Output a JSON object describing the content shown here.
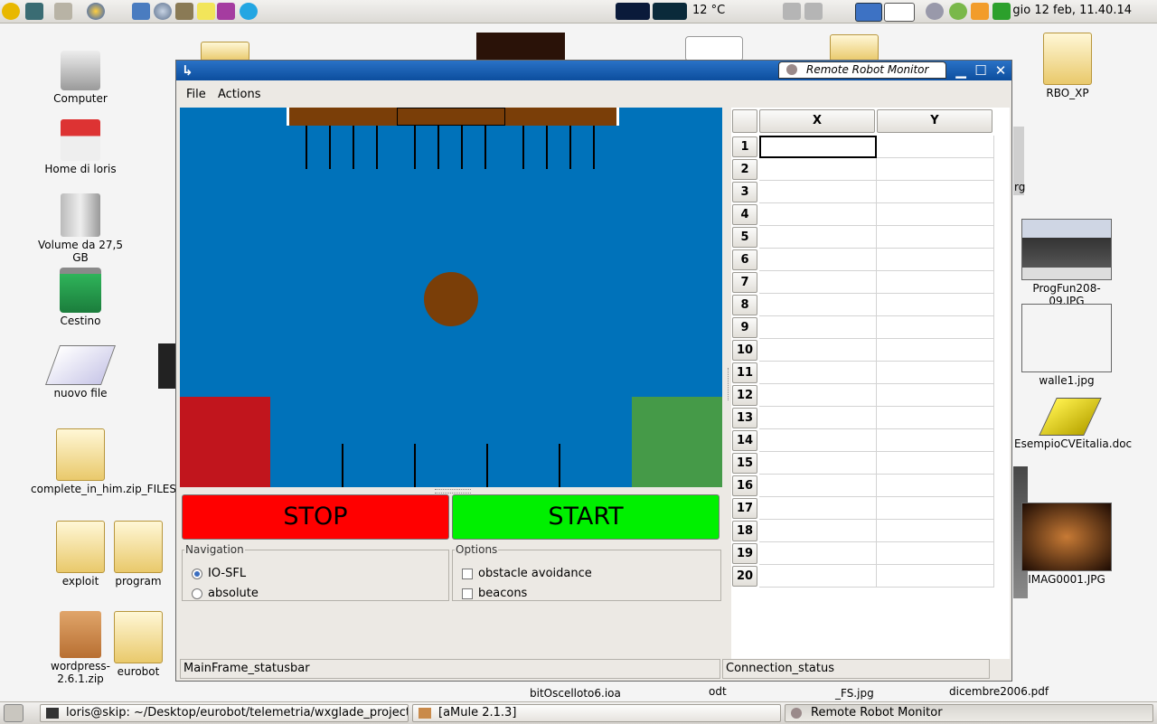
{
  "top_panel": {
    "weather": "12 °C",
    "clock": "gio 12 feb, 11.40.14"
  },
  "desktop": {
    "icons": [
      {
        "label": "Computer"
      },
      {
        "label": "Home di loris"
      },
      {
        "label": "Volume da 27,5 GB"
      },
      {
        "label": "Cestino"
      },
      {
        "label": "nuovo file"
      },
      {
        "label": "complete_in_him.zip_FILES"
      },
      {
        "label": "exploit"
      },
      {
        "label": "program"
      },
      {
        "label": "wordpress-2.6.1.zip"
      },
      {
        "label": "eurobot"
      },
      {
        "label": "RBO_XP"
      },
      {
        "label": "ProgFun208-09.JPG"
      },
      {
        "label": "walle1.jpg"
      },
      {
        "label": "EsempioCVEitalia.doc"
      },
      {
        "label": "IMAG0001.JPG"
      },
      {
        "label": "rg"
      },
      {
        "label": "bitOscelloto6.ioa"
      },
      {
        "label": "odt"
      },
      {
        "label": "_FS.jpg"
      },
      {
        "label": "dicembre2006.pdf"
      }
    ]
  },
  "window": {
    "title": "Remote Robot Monitor",
    "menu": {
      "file": "File",
      "actions": "Actions"
    },
    "buttons": {
      "stop": "STOP",
      "start": "START"
    },
    "navigation": {
      "legend": "Navigation",
      "options": [
        {
          "label": "IO-SFL",
          "selected": true
        },
        {
          "label": "absolute",
          "selected": false
        }
      ]
    },
    "options": {
      "legend": "Options",
      "items": [
        {
          "label": "obstacle avoidance",
          "checked": false
        },
        {
          "label": "beacons",
          "checked": false
        }
      ]
    },
    "grid": {
      "columns": [
        "X",
        "Y"
      ],
      "rows": [
        "1",
        "2",
        "3",
        "4",
        "5",
        "6",
        "7",
        "8",
        "9",
        "10",
        "11",
        "12",
        "13",
        "14",
        "15",
        "16",
        "17",
        "18",
        "19",
        "20"
      ]
    },
    "status": {
      "left": "MainFrame_statusbar",
      "right": "Connection_status"
    }
  },
  "taskbar": {
    "tasks": [
      {
        "label": "loris@skip: ~/Desktop/eurobot/telemetria/wxglade_project"
      },
      {
        "label": "[aMule 2.1.3]"
      },
      {
        "label": "Remote Robot Monitor"
      }
    ]
  },
  "colors": {
    "field": "#0072ba",
    "table": "#7a3e08",
    "red_zone": "#c1151d",
    "green_zone": "#459a48",
    "stop": "#ff0000",
    "start": "#00f000",
    "titlebar": "#1560b6"
  }
}
